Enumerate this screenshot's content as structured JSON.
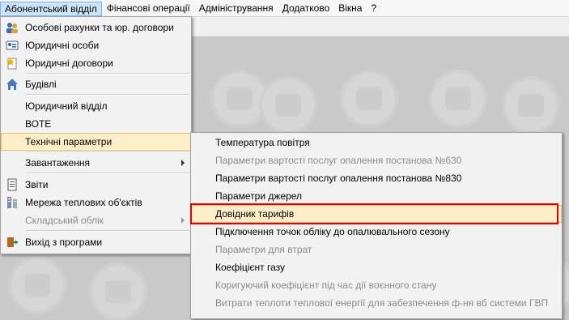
{
  "menubar": {
    "items": [
      "Абонентський відділ",
      "Фінансові операції",
      "Адміністрування",
      "Додатково",
      "Вікна",
      "?"
    ]
  },
  "main_menu": {
    "items": [
      {
        "label": "Особові рахунки та юр. договори",
        "icon": "people-icon"
      },
      {
        "label": "Юридичні особи",
        "icon": "id-card-icon"
      },
      {
        "label": "Юридичні договори",
        "icon": "contract-star-icon"
      },
      {
        "label": "Будівлі",
        "icon": "house-icon"
      },
      {
        "label": "Юридичний відділ"
      },
      {
        "label": "ВОТЕ"
      },
      {
        "label": "Технічні параметри"
      },
      {
        "label": "Завантаження"
      },
      {
        "label": "Звіти",
        "icon": "report-icon"
      },
      {
        "label": "Мережа теплових об'єктів",
        "icon": "network-icon"
      },
      {
        "label": "Складський облік"
      },
      {
        "label": "Вихід з програми",
        "icon": "exit-door-icon"
      }
    ]
  },
  "sub_menu": {
    "items": [
      "Температура повітря",
      "Параметри вартості послуг опалення постанова №630",
      "Параметри вартості послуг опалення постанова №830",
      "Параметри джерел",
      "Довідник тарифів",
      "Підключення точок обліку до опалювального сезону",
      "Параметри для втрат",
      "Коефіцієнт газу",
      "Коригуючий коефіцієнт під час дії воєнного стану",
      "Витрати теплоти теплової енергії для забезпечення ф-ня вб системи ГВП"
    ]
  },
  "colors": {
    "highlight": "#fceec9",
    "selection_outline": "#e00000",
    "menubar_active": "#cce4f7"
  }
}
